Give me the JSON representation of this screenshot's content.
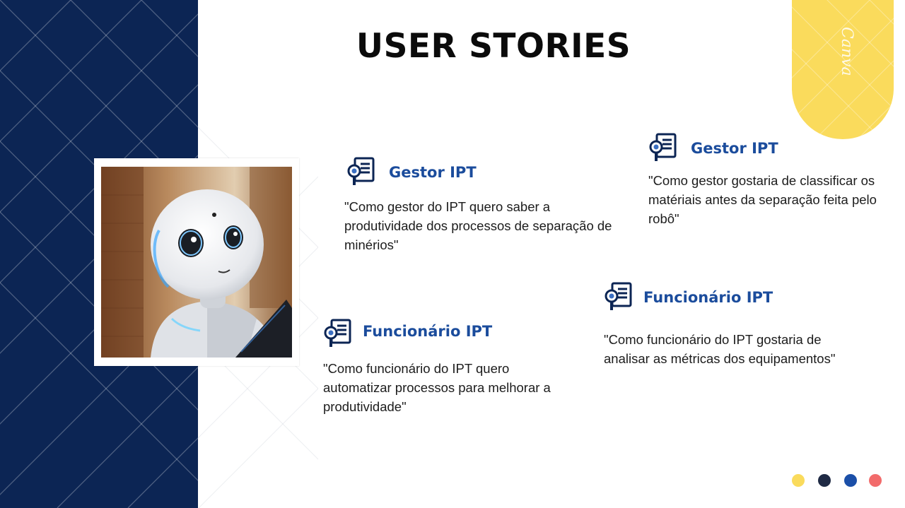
{
  "slide": {
    "title": "USER STORIES",
    "brand_mark": "Canva",
    "colors": {
      "navy": "#0c2554",
      "accent_blue": "#1b4c9c",
      "yellow": "#fadb5c",
      "dark": "#1c1c1c"
    }
  },
  "photo": {
    "subject": "robot-photo"
  },
  "stories": [
    {
      "title": "Gestor IPT",
      "text": "\"Como gestor do IPT quero saber a produtividade dos processos de separação de minérios\"",
      "icon": "document-search-icon"
    },
    {
      "title": "Gestor IPT",
      "text": "\"Como gestor gostaria de classificar os matériais antes da separação feita pelo robô\"",
      "icon": "document-search-icon"
    },
    {
      "title": "Funcionário IPT",
      "text": "\"Como funcionário do IPT quero automatizar processos para melhorar a produtividade\"",
      "icon": "document-search-icon"
    },
    {
      "title": "Funcionário IPT",
      "text": "\"Como funcionário do IPT gostaria de analisar as métricas dos equipamentos\"",
      "icon": "document-search-icon"
    }
  ],
  "pagination_dots": [
    {
      "color": "#fadb5c"
    },
    {
      "color": "#1f2a44"
    },
    {
      "color": "#1b4fa8"
    },
    {
      "color": "#f26b6b"
    }
  ]
}
